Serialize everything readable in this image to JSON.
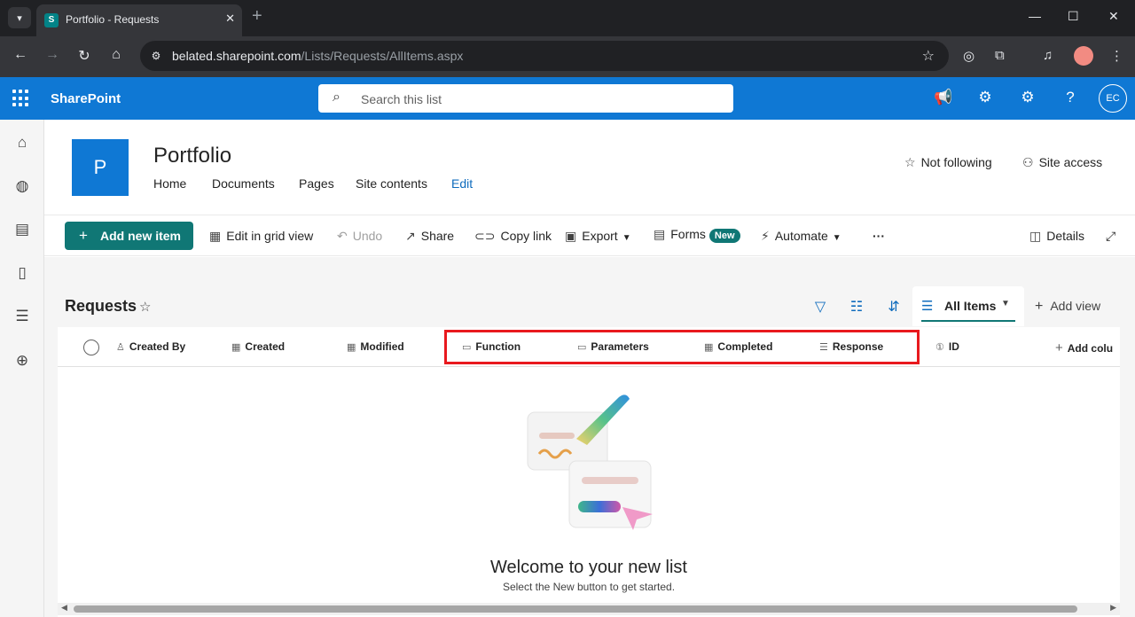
{
  "browser": {
    "tab_title": "Portfolio - Requests",
    "url_domain": "belated.sharepoint.com",
    "url_path": "/Lists/Requests/AllItems.aspx"
  },
  "suite": {
    "brand": "SharePoint",
    "search_placeholder": "Search this list",
    "avatar_initials": "EC"
  },
  "site": {
    "logo_letter": "P",
    "title": "Portfolio",
    "nav": [
      "Home",
      "Documents",
      "Pages",
      "Site contents",
      "Edit"
    ],
    "follow_label": "Not following",
    "access_label": "Site access"
  },
  "commands": {
    "add_new_item": "Add new item",
    "edit_grid": "Edit in grid view",
    "undo": "Undo",
    "share": "Share",
    "copy_link": "Copy link",
    "export": "Export",
    "forms": "Forms",
    "forms_badge": "New",
    "automate": "Automate",
    "more": "···",
    "details": "Details"
  },
  "list": {
    "title": "Requests",
    "view_name": "All Items",
    "add_view": "Add view",
    "columns": [
      "Created By",
      "Created",
      "Modified",
      "Function",
      "Parameters",
      "Completed",
      "Response",
      "ID",
      "Add colu"
    ],
    "welcome_title": "Welcome to your new list",
    "welcome_subtitle": "Select the New button to get started."
  },
  "colors": {
    "suite_blue": "#0f78d4",
    "teal_accent": "#107775",
    "highlight_red": "#e8191e"
  }
}
